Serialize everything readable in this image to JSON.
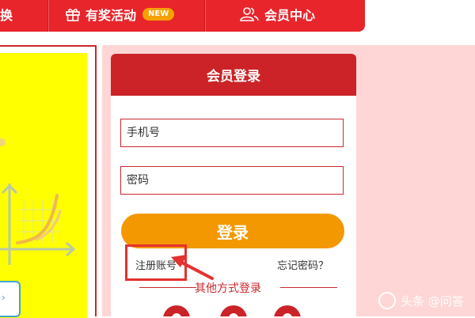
{
  "nav": {
    "item_partial": "换",
    "rewards": "有奖活动",
    "new_badge": "NEW",
    "member_center": "会员中心"
  },
  "login": {
    "title": "会员登录",
    "phone_placeholder": "手机号",
    "password_placeholder": "密码",
    "submit": "登录",
    "register": "注册账号",
    "forgot": "忘记密码？",
    "other": "其他方式登录"
  },
  "left_panel": {
    "teal_box_glyph": "›"
  },
  "watermark": "头条 @问答",
  "colors": {
    "nav_red": "#e8252b",
    "header_red": "#cb2327",
    "button_orange": "#f39800",
    "pink_bg": "#ffd6d6",
    "highlight_red": "#e53030"
  }
}
